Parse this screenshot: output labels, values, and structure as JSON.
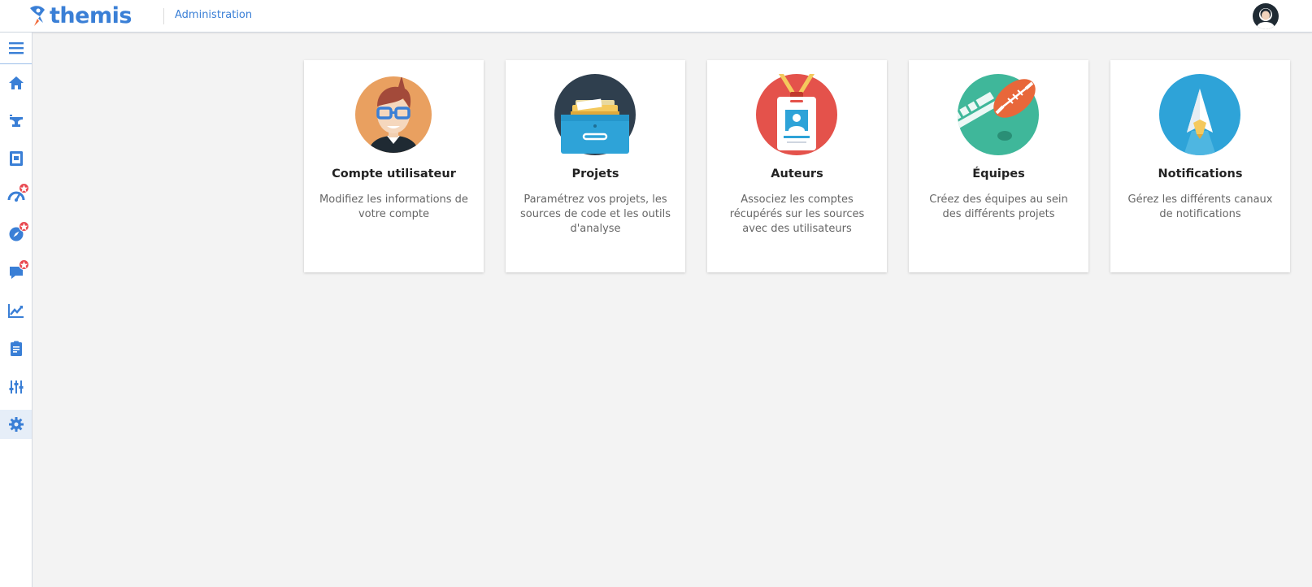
{
  "header": {
    "app_name": "themis",
    "section": "Administration",
    "logo_icon": "rocket-icon",
    "avatar_icon": "user-avatar-icon"
  },
  "sidebar": {
    "items": [
      {
        "icon": "hamburger-menu-icon"
      },
      {
        "icon": "home-icon"
      },
      {
        "icon": "anvil-icon"
      },
      {
        "icon": "book-icon"
      },
      {
        "icon": "speedometer-icon",
        "badge": true
      },
      {
        "icon": "compass-icon",
        "badge": true
      },
      {
        "icon": "chat-bubble-icon",
        "badge": true
      },
      {
        "icon": "trend-chart-icon"
      },
      {
        "icon": "clipboard-icon"
      },
      {
        "icon": "sliders-icon"
      },
      {
        "icon": "gear-icon",
        "active": true
      }
    ]
  },
  "cards": [
    {
      "title": "Compte utilisateur",
      "desc": "Modifiez les informations de votre compte",
      "icon": "user-account-illustration"
    },
    {
      "title": "Projets",
      "desc": "Paramétrez vos projets, les sources de code et les outils d'analyse",
      "icon": "file-drawer-illustration"
    },
    {
      "title": "Auteurs",
      "desc": "Associez les comptes récupérés sur les sources avec des utilisateurs",
      "icon": "id-badge-illustration"
    },
    {
      "title": "Équipes",
      "desc": "Créez des équipes au sein des différents projets",
      "icon": "football-illustration"
    },
    {
      "title": "Notifications",
      "desc": "Gérez les différents canaux de notifications",
      "icon": "paper-plane-illustration"
    }
  ],
  "colors": {
    "accent": "#3a7fd6",
    "background": "#f3f3f3",
    "badge": "#e8474f"
  }
}
